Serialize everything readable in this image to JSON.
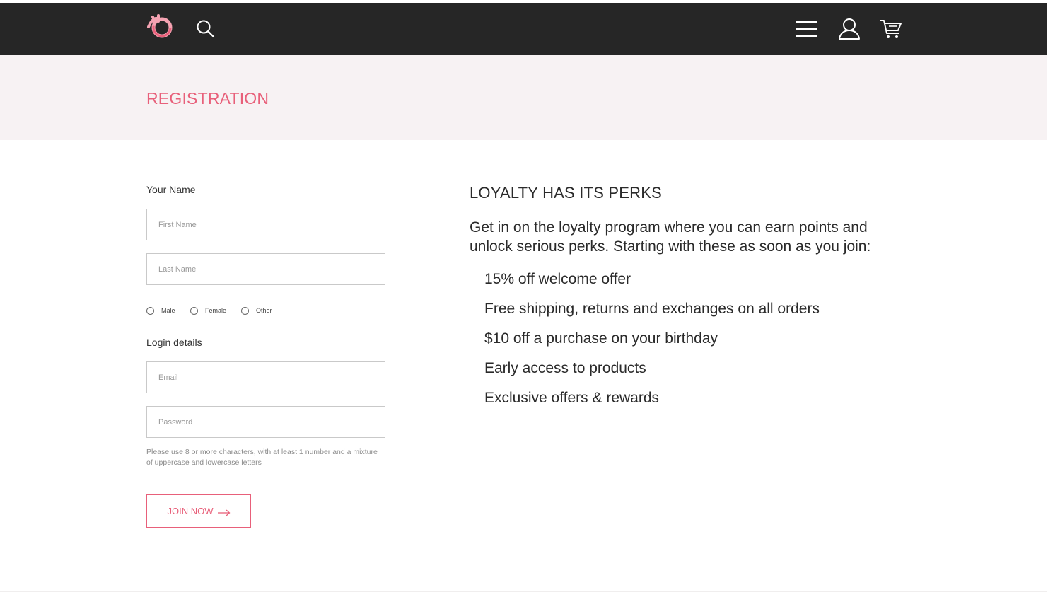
{
  "header": {
    "logo_icon": "brand-logo-icon",
    "search_icon": "search-icon",
    "menu_icon": "hamburger-menu-icon",
    "account_icon": "user-account-icon",
    "cart_icon": "shopping-cart-icon",
    "background_color": "#262626"
  },
  "hero": {
    "title": "REGISTRATION",
    "background_color": "#f7f2f3",
    "title_color": "#e8607a"
  },
  "form": {
    "name_section_label": "Your Name",
    "first_name_placeholder": "First Name",
    "last_name_placeholder": "Last Name",
    "gender_options": [
      "Male",
      "Female",
      "Other"
    ],
    "login_section_label": "Login details",
    "email_placeholder": "Email",
    "password_placeholder": "Password",
    "password_hint": "Please use 8 or more characters, with at least 1 number and a mixture of uppercase and lowercase letters",
    "submit_label": "JOIN NOW",
    "submit_icon": "arrow-right-icon",
    "accent_color": "#e8607a"
  },
  "perks": {
    "title": "LOYALTY HAS ITS PERKS",
    "intro": "Get in on the loyalty program where you can earn points and unlock serious perks. Starting with these as soon as you join:",
    "items": [
      "15% off welcome offer",
      "Free shipping, returns and exchanges on all orders",
      "$10 off a purchase on your birthday",
      "Early access to products",
      "Exclusive offers & rewards"
    ]
  }
}
